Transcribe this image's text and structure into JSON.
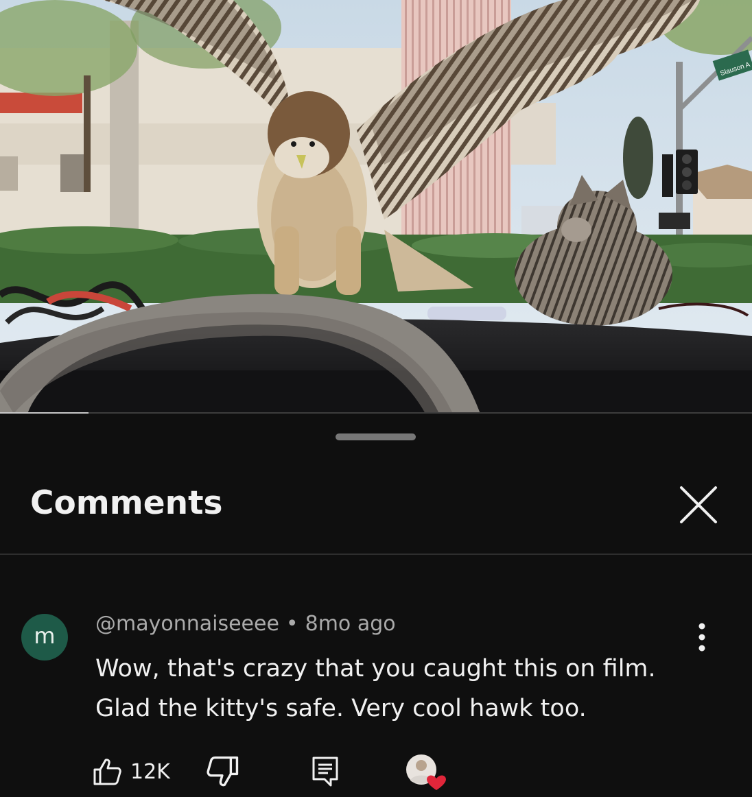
{
  "video": {
    "street_sign": "Slauson A",
    "progress": 0.118
  },
  "comments_panel": {
    "title": "Comments",
    "close_icon": "close-icon"
  },
  "comment": {
    "avatar_letter": "m",
    "author": "@mayonnaiseeee",
    "separator": "•",
    "time": "8mo ago",
    "text_line1": "Wow, that's crazy that you caught this on film.",
    "text_line2": "Glad the kitty's safe. Very cool hawk too.",
    "likes": "12K",
    "icons": {
      "like": "thumbs-up-icon",
      "dislike": "thumbs-down-icon",
      "reply": "reply-icon",
      "more": "more-vert-icon",
      "creator_heart": "creator-heart-icon"
    },
    "colors": {
      "avatar_bg": "#1e5a48",
      "heart": "#e0263a"
    }
  }
}
